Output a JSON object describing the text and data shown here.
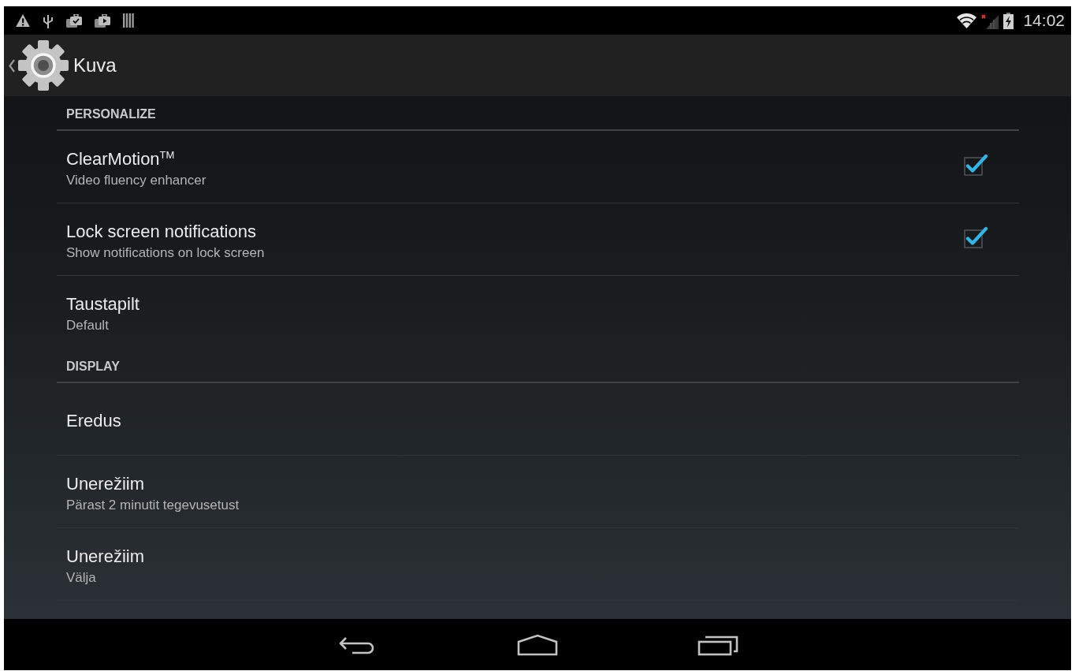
{
  "status_bar": {
    "time": "14:02"
  },
  "action_bar": {
    "title": "Kuva"
  },
  "sections": [
    {
      "header": "PERSONALIZE",
      "items": [
        {
          "kind": "checkbox",
          "title": "ClearMotion$^{TM}$",
          "summary": "Video fluency enhancer",
          "checked": true
        },
        {
          "kind": "checkbox",
          "title": "Lock screen notifications",
          "summary": "Show notifications on lock screen",
          "checked": true
        },
        {
          "kind": "link",
          "title": "Taustapilt",
          "summary": "Default"
        }
      ]
    },
    {
      "header": "DISPLAY",
      "items": [
        {
          "kind": "link",
          "title": "Eredus"
        },
        {
          "kind": "link",
          "title": "Unerežiim",
          "summary": "Pärast 2 minutit tegevusetust"
        },
        {
          "kind": "link",
          "title": "Unerežiim",
          "summary": "Välja"
        }
      ]
    }
  ]
}
